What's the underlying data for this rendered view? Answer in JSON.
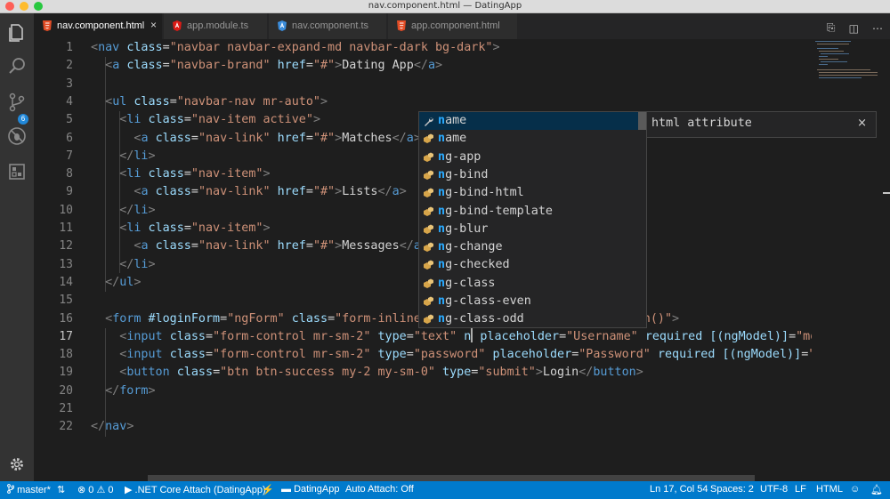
{
  "window": {
    "title": "nav.component.html — DatingApp"
  },
  "activity": {
    "scm_badge": "6"
  },
  "tabs": [
    {
      "label": "nav.component.html",
      "kind": "html",
      "active": true
    },
    {
      "label": "app.module.ts",
      "kind": "angular"
    },
    {
      "label": "nav.component.ts",
      "kind": "ts"
    },
    {
      "label": "app.component.html",
      "kind": "html"
    }
  ],
  "tab_close": "×",
  "editor": {
    "current_line": 17,
    "line_numbers": [
      "1",
      "2",
      "3",
      "4",
      "5",
      "6",
      "7",
      "8",
      "9",
      "10",
      "11",
      "12",
      "13",
      "14",
      "15",
      "16",
      "17",
      "18",
      "19",
      "20",
      "21",
      "22"
    ]
  },
  "suggest": {
    "typed": "n",
    "items": [
      {
        "label": "name",
        "rest": "ame",
        "icon": "wrench-icon"
      },
      {
        "label": "name",
        "rest": "ame",
        "icon": "property-icon"
      },
      {
        "label": "ng-app",
        "rest": "g-app",
        "icon": "property-icon"
      },
      {
        "label": "ng-bind",
        "rest": "g-bind",
        "icon": "property-icon"
      },
      {
        "label": "ng-bind-html",
        "rest": "g-bind-html",
        "icon": "property-icon"
      },
      {
        "label": "ng-bind-template",
        "rest": "g-bind-template",
        "icon": "property-icon"
      },
      {
        "label": "ng-blur",
        "rest": "g-blur",
        "icon": "property-icon"
      },
      {
        "label": "ng-change",
        "rest": "g-change",
        "icon": "property-icon"
      },
      {
        "label": "ng-checked",
        "rest": "g-checked",
        "icon": "property-icon"
      },
      {
        "label": "ng-class",
        "rest": "g-class",
        "icon": "property-icon"
      },
      {
        "label": "ng-class-even",
        "rest": "g-class-even",
        "icon": "property-icon"
      },
      {
        "label": "ng-class-odd",
        "rest": "g-class-odd",
        "icon": "property-icon"
      }
    ],
    "detail": "html attribute",
    "detail_close": "×"
  },
  "status": {
    "branch": "master*",
    "errors": "0",
    "warnings": "0",
    "debug": ".NET Core Attach (DatingApp)",
    "folder": "DatingApp",
    "auto_attach": "Auto Attach: Off",
    "position": "Ln 17, Col 54",
    "spaces": "Spaces: 2",
    "encoding": "UTF-8",
    "eol": "LF",
    "language": "HTML"
  },
  "colors": {
    "tag": "#569cd6",
    "attribute": "#9cdcfe",
    "string": "#ce9178",
    "status_bar": "#007acc",
    "match": "#2aaaff"
  }
}
